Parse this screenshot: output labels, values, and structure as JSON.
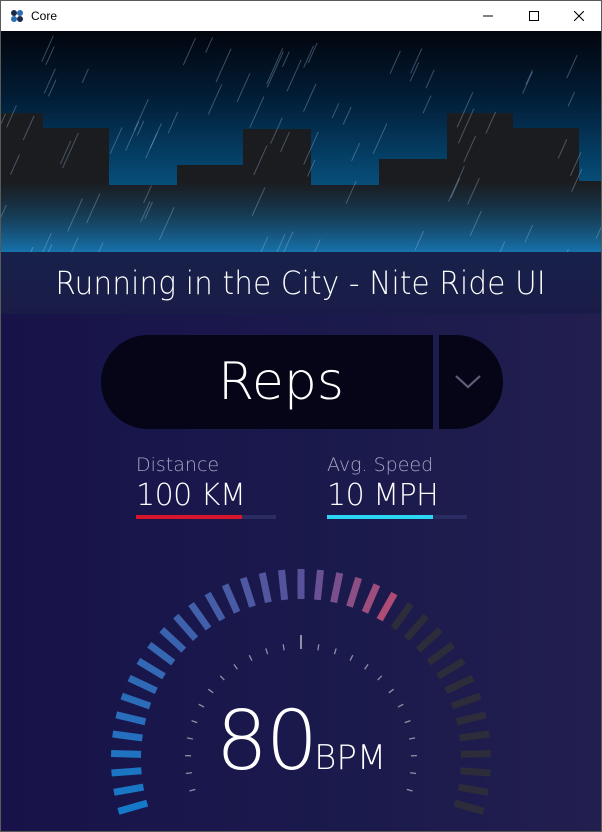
{
  "window": {
    "title": "Core",
    "buttons": {
      "minimize": "minimize-icon",
      "maximize": "maximize-icon",
      "close": "close-icon"
    }
  },
  "hero": {
    "title": "Running in the City - Nite Ride UI"
  },
  "workout": {
    "selected": "Reps",
    "toggle_icon": "chevron-down-icon"
  },
  "stats": {
    "distance": {
      "label": "Distance",
      "value": "100 KM",
      "progress": 0.76,
      "color": "#d7162c"
    },
    "speed": {
      "label": "Avg. Speed",
      "value": "10 MPH",
      "progress": 0.76,
      "color": "#2ad6f4"
    }
  },
  "heart_rate": {
    "value": "80",
    "unit": "BPM",
    "level": 0.65,
    "colors": {
      "low": "#1579c9",
      "mid": "#58529a",
      "high": "#b54c73",
      "inactive": "#2c2c3a"
    }
  }
}
